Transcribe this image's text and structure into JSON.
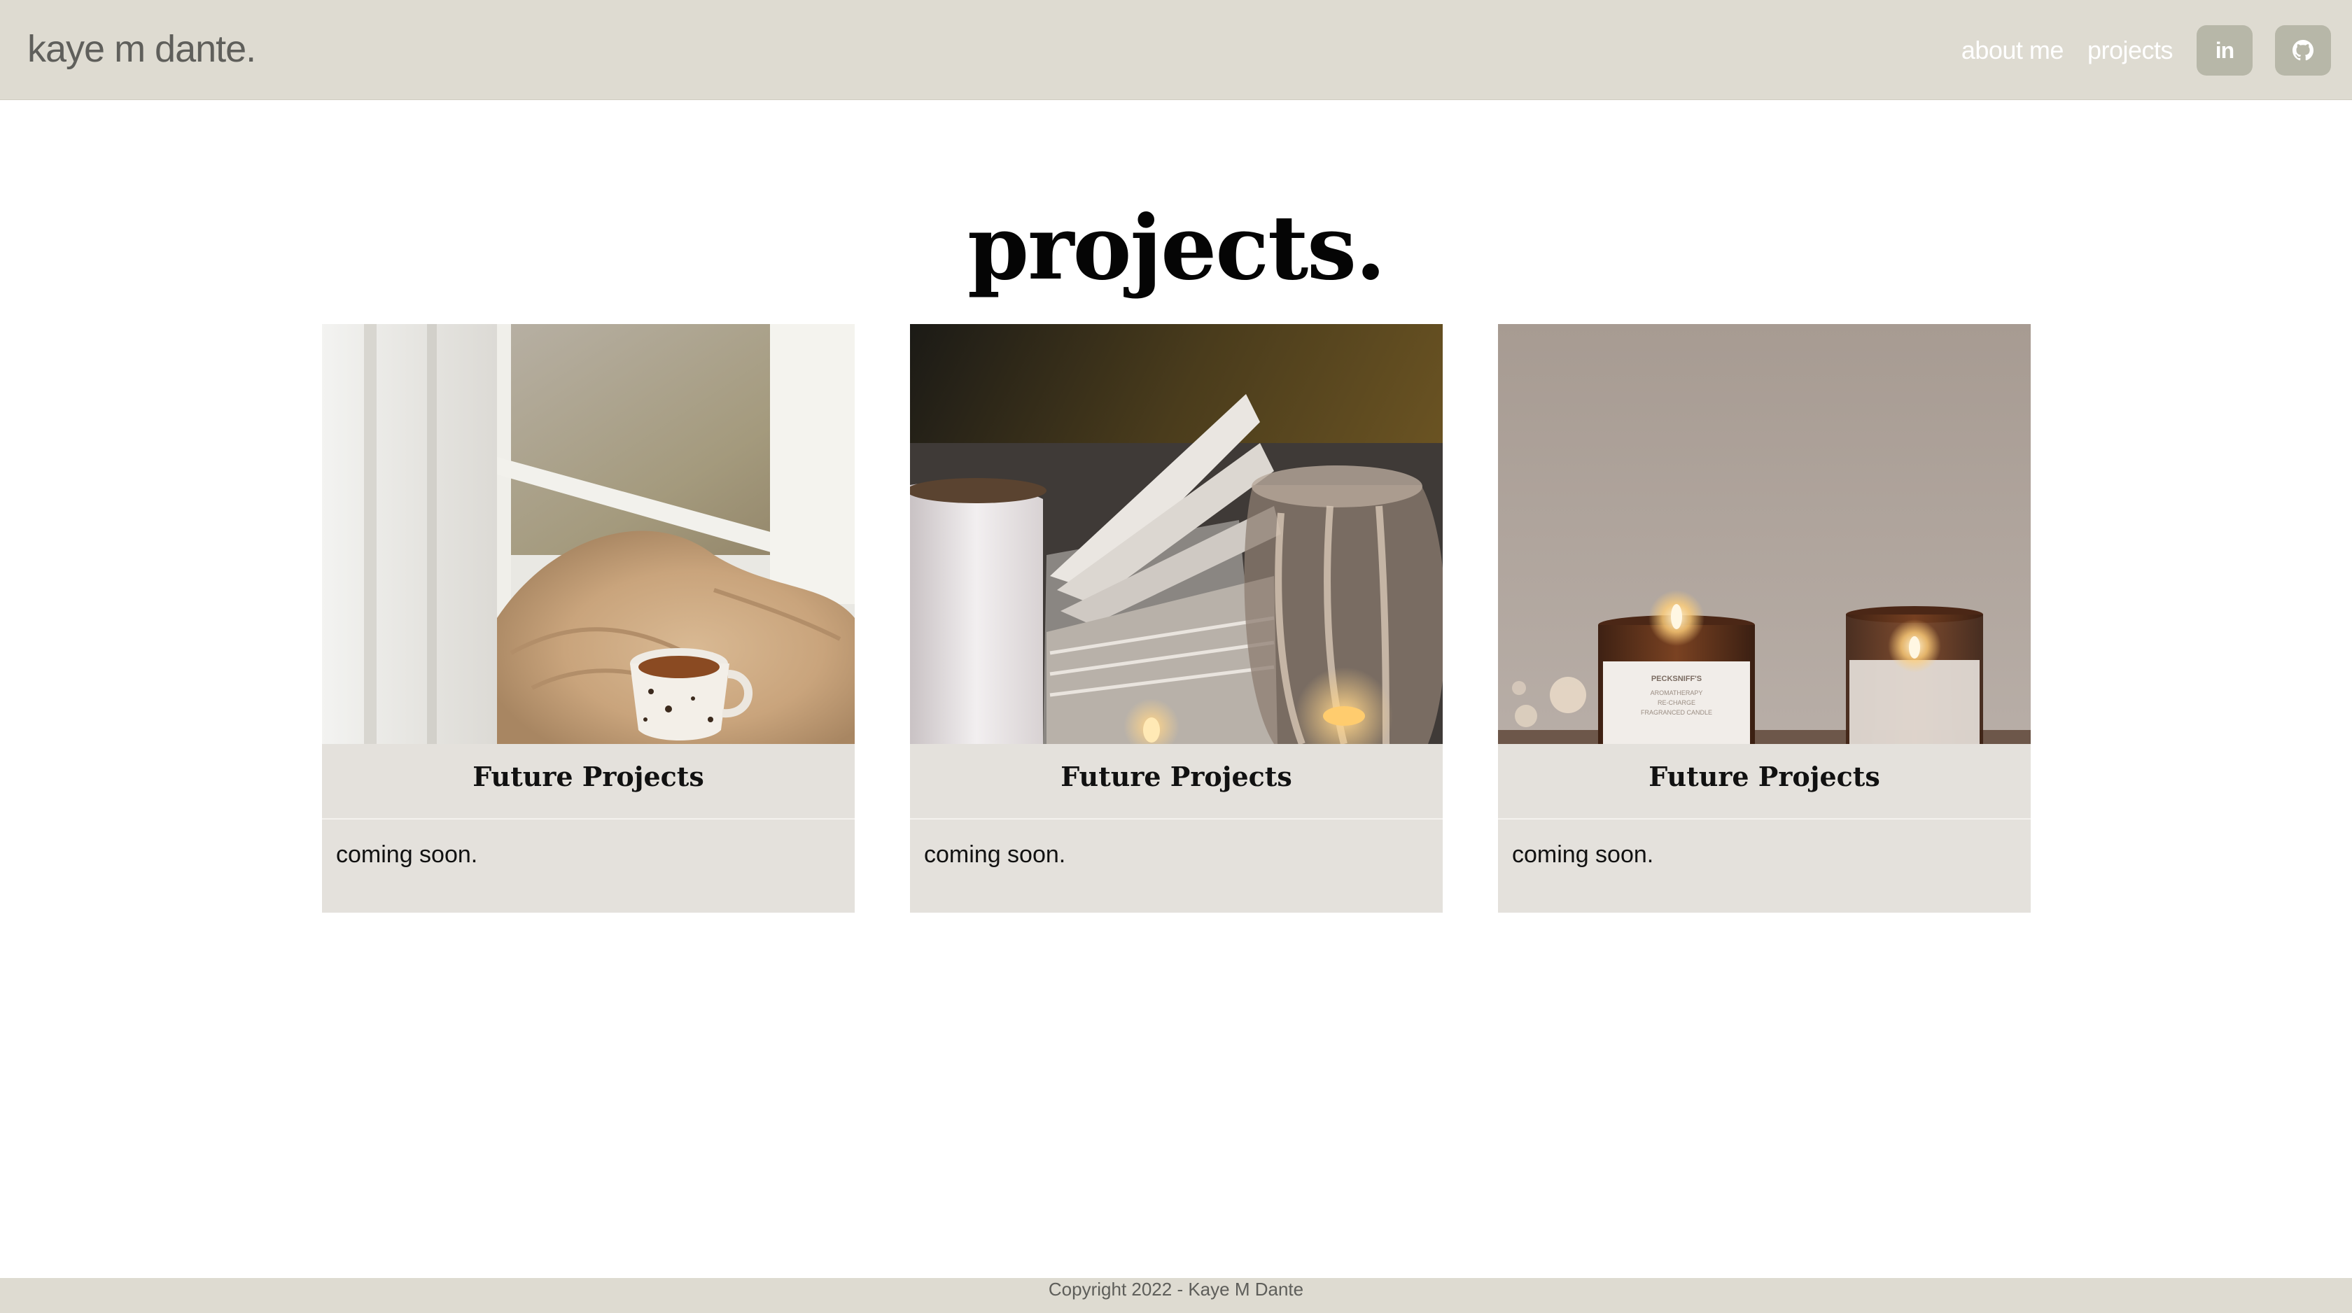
{
  "header": {
    "brand": "kaye m dante.",
    "nav": {
      "about_label": "about me",
      "projects_label": "projects"
    },
    "social": {
      "linkedin_icon": "linkedin-icon",
      "github_icon": "github-icon",
      "linkedin_text": "in"
    }
  },
  "main": {
    "title": "projects.",
    "cards": [
      {
        "image": "cozy-tea-mug-sweater-window-photo",
        "title": "Future Projects",
        "description": "coming soon."
      },
      {
        "image": "open-book-candles-mug-photo",
        "title": "Future Projects",
        "description": "coming soon."
      },
      {
        "image": "two-amber-candles-photo",
        "title": "Future Projects",
        "description": "coming soon."
      }
    ]
  },
  "footer": {
    "copyright": "Copyright 2022 - Kaye M Dante"
  },
  "colors": {
    "navbar_bg": "#dedbd1",
    "social_button_bg": "#b7b7a8",
    "card_bg": "#e4e1dc",
    "brand_text": "#5f5f5b"
  }
}
